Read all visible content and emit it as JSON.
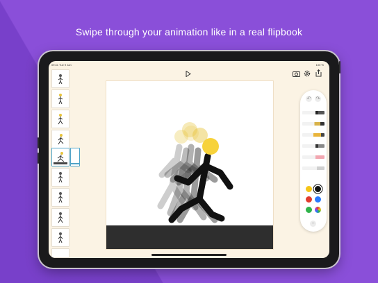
{
  "headline": "Swipe through your animation like in a real flipbook",
  "status_bar": {
    "time_date": "09:41  Tue 9 Jan",
    "battery": "100 %"
  },
  "icons": {
    "grid": "grid-icon",
    "play": "play-icon",
    "camera": "camera-import-icon",
    "settings": "gear-icon",
    "share": "share-icon"
  },
  "frames": {
    "count": 10,
    "selected_index": 4
  },
  "palette": {
    "undo_icon": "undo-icon",
    "redo_icon": "redo-icon",
    "tools": [
      "pen-tool",
      "pencil-tool",
      "marker-tool",
      "brush-tool",
      "eraser-tool",
      "ruler-tool"
    ],
    "colors": [
      "#f5c518",
      "#111111",
      "#e23b2e",
      "#2979ff",
      "#2fb34a",
      "color-wheel"
    ],
    "selected_color": "#111111",
    "minus_icon": "minus-icon"
  }
}
